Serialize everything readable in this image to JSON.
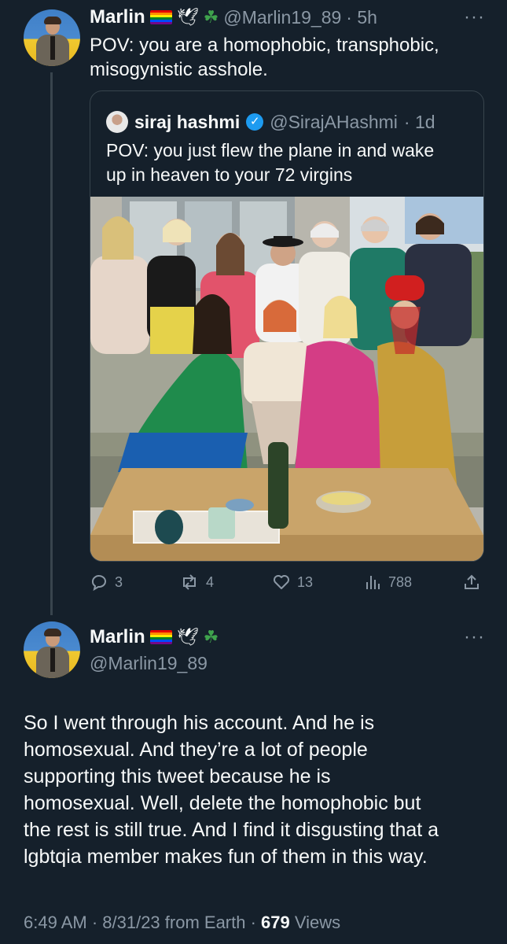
{
  "tweet1": {
    "name": "Marlin",
    "name_emojis": [
      "rainbow-flag",
      "dove",
      "shamrock"
    ],
    "handle": "@Marlin19_89",
    "time": "· 5h",
    "text_line1": "POV: you are a homophobic, transphobic,",
    "text_line2": "misogynistic asshole.",
    "more": "···"
  },
  "quoted": {
    "name": "siraj hashmi",
    "handle": "@SirajAHashmi",
    "time": "· 1d",
    "text_line1": "POV: you just flew the plane in and wake",
    "text_line2": "up in heaven to your 72 virgins"
  },
  "actions": {
    "replies": "3",
    "retweets": "4",
    "likes": "13",
    "views": "788"
  },
  "tweet2": {
    "name": "Marlin",
    "handle": "@Marlin19_89",
    "more": "···",
    "lines": [
      "So I went through his account. And he is",
      "homosexual. And they’re a lot of people",
      "supporting this tweet because he is",
      "homosexual. Well, delete the homophobic but",
      "the rest is still true. And I find it disgusting that a",
      "lgbtqia member makes fun of them in this way."
    ],
    "meta": "6:49 AM · 8/31/23 from Earth · ",
    "views_count": "679",
    "views_label": " Views"
  },
  "colors": {
    "background": "#15202b",
    "text": "#f7f9f9",
    "muted": "#8b98a5",
    "border": "#38444d",
    "verified": "#1d9bf0"
  }
}
